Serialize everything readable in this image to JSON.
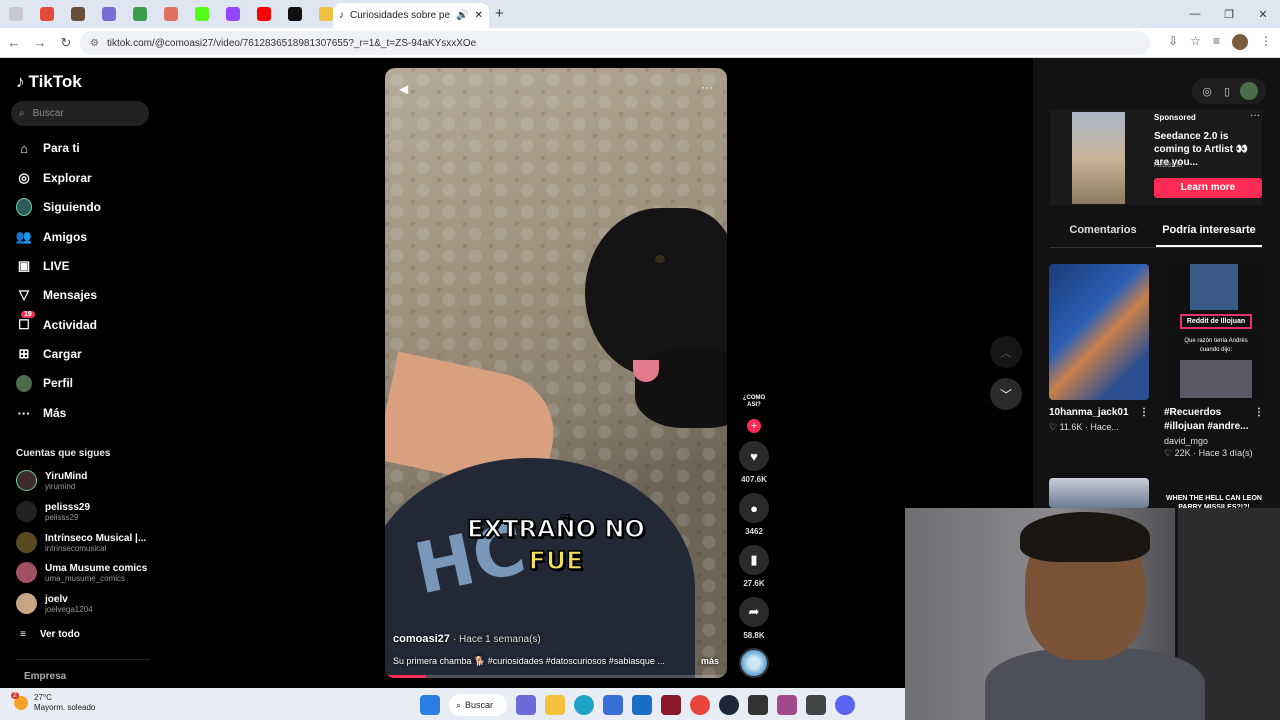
{
  "browser": {
    "tab_title": "Curiosidades sobre perros",
    "url": "tiktok.com/@comoasi27/video/7612836518981307655?_r=1&_t=ZS-94aKYsxxXOe"
  },
  "sidebar": {
    "logo": "TikTok",
    "search_placeholder": "Buscar",
    "nav": [
      {
        "label": "Para ti",
        "icon": "home-icon"
      },
      {
        "label": "Explorar",
        "icon": "compass-icon"
      },
      {
        "label": "Siguiendo",
        "icon": "following-avatar-icon"
      },
      {
        "label": "Amigos",
        "icon": "friends-icon"
      },
      {
        "label": "LIVE",
        "icon": "live-icon"
      },
      {
        "label": "Mensajes",
        "icon": "send-icon"
      },
      {
        "label": "Actividad",
        "icon": "activity-icon",
        "badge": "19"
      },
      {
        "label": "Cargar",
        "icon": "upload-icon"
      },
      {
        "label": "Perfil",
        "icon": "profile-avatar-icon"
      },
      {
        "label": "Más",
        "icon": "more-icon"
      }
    ],
    "following_title": "Cuentas que sigues",
    "accounts": [
      {
        "name": "YiruMind",
        "handle": "yirumind"
      },
      {
        "name": "pelisss29",
        "handle": "pelisss29"
      },
      {
        "name": "Intrínseco Musical |...",
        "handle": "intrinsecomusical"
      },
      {
        "name": "Uma Musume comics",
        "handle": "uma_musume_comics"
      },
      {
        "name": "joelv",
        "handle": "joelvega1204"
      }
    ],
    "ver_todo": "Ver todo",
    "empresa": "Empresa"
  },
  "video": {
    "caption_line1": "EXTRAÑO NO",
    "caption_line2": "FUE",
    "author": "comoasi27",
    "time": "· Hace 1 semana(s)",
    "description": "Su primera chamba 🐕 #curiosidades #datoscuriosos #sabiasque ...",
    "more": "más",
    "progress": 0.12
  },
  "actions": {
    "creator_tag": "¿COMO ASI?",
    "likes": "407.6K",
    "comments": "3462",
    "saves": "27.6K",
    "shares": "58.8K"
  },
  "right_panel": {
    "ad": {
      "sponsored": "Sponsored",
      "title": "Seedance 2.0 is coming to Artlist 👀 are you...",
      "site": "Artlist.io",
      "button": "Learn more"
    },
    "tabs": [
      "Comentarios",
      "Podría interesarte"
    ],
    "recommendations": [
      {
        "title": "",
        "user": "10hanma_jack01",
        "stats": "♡ 11.6K · Hace..."
      },
      {
        "title": "#Recuerdos #illojuan #andre...",
        "user": "david_mgo",
        "stats": "♡ 22K · Hace 3 día(s)",
        "thumb_text": "Reddit de Illojuan",
        "thumb_sub": "Que razón tenía Andrés cuando dijo:"
      },
      {
        "title": "",
        "thumb_text": "WHEN THE HELL CAN LEON PARRY MISSILES?!?!"
      }
    ]
  },
  "taskbar": {
    "temp": "27°C",
    "weather": "Mayorm. soleado",
    "weather_badge": "2",
    "search": "Buscar"
  }
}
